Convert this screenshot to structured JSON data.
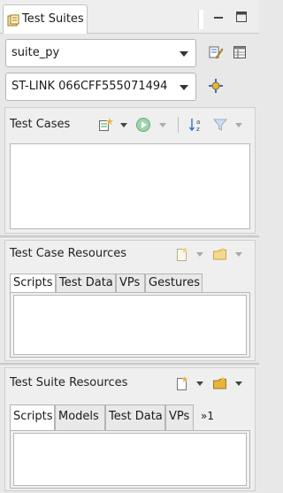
{
  "view": {
    "tab_title": "Test Suites",
    "tab_icon": "test-suites-icon"
  },
  "suite_combo": {
    "value": "suite_py"
  },
  "device_combo": {
    "value": "ST-LINK 066CFF555071494"
  },
  "test_cases": {
    "title": "Test Cases"
  },
  "test_case_resources": {
    "title": "Test Case Resources",
    "tabs": [
      "Scripts",
      "Test Data",
      "VPs",
      "Gestures"
    ],
    "selected_tab": "Scripts"
  },
  "test_suite_resources": {
    "title": "Test Suite Resources",
    "tabs": [
      "Scripts",
      "Models",
      "Test Data",
      "VPs"
    ],
    "overflow_label": "»1",
    "selected_tab": "Scripts"
  },
  "colors": {
    "accent_blue": "#3a6fc4",
    "folder_yellow": "#e7b33a",
    "green_run": "#3aa35b"
  }
}
